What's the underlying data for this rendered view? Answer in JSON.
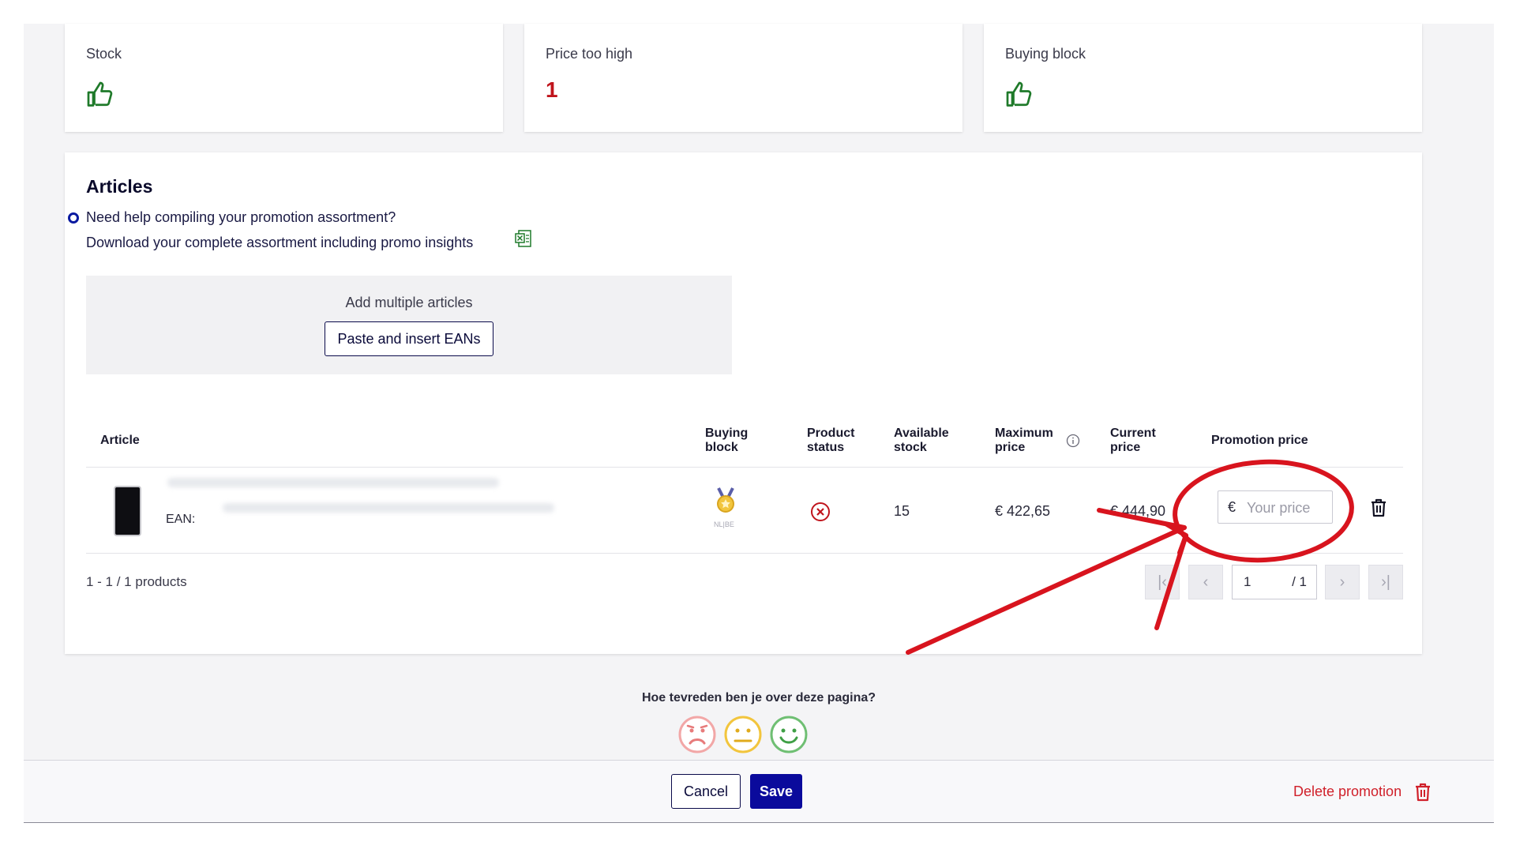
{
  "kpis": [
    {
      "title": "Stock",
      "icon": "thumbs-up-icon"
    },
    {
      "title": "Price too high",
      "value": "1"
    },
    {
      "title": "Buying block",
      "icon": "thumbs-up-icon"
    }
  ],
  "articles": {
    "title": "Articles",
    "help_line1": "Need help compiling your promotion assortment?",
    "help_line2": "Download your complete assortment including promo insights",
    "add_multiple_label": "Add multiple articles",
    "paste_button": "Paste and insert EANs"
  },
  "table": {
    "headers": {
      "article": "Article",
      "buying_block": [
        "Buying",
        "block"
      ],
      "product_status": [
        "Product",
        "status"
      ],
      "available_stock": [
        "Available",
        "stock"
      ],
      "maximum_price": [
        "Maximum",
        "price"
      ],
      "current_price": [
        "Current",
        "price"
      ],
      "promotion_price": "Promotion price"
    },
    "rows": [
      {
        "ean_label": "EAN:",
        "badge_text": "NL|BE",
        "available_stock": "15",
        "maximum_price": "€ 422,65",
        "current_price": "€ 444,90",
        "promotion_currency": "€",
        "promotion_placeholder": "Your price"
      }
    ],
    "range_text": "1 - 1 / 1 products",
    "pager": {
      "current": "1",
      "total": "/ 1"
    }
  },
  "survey": {
    "question": "Hoe tevreden ben je over deze pagina?"
  },
  "footer": {
    "cancel": "Cancel",
    "save": "Save",
    "delete": "Delete promotion"
  },
  "colors": {
    "primary": "#0a0a9c",
    "danger": "#d0202a",
    "success": "#1f7a2a",
    "annotation": "#d8141e"
  }
}
